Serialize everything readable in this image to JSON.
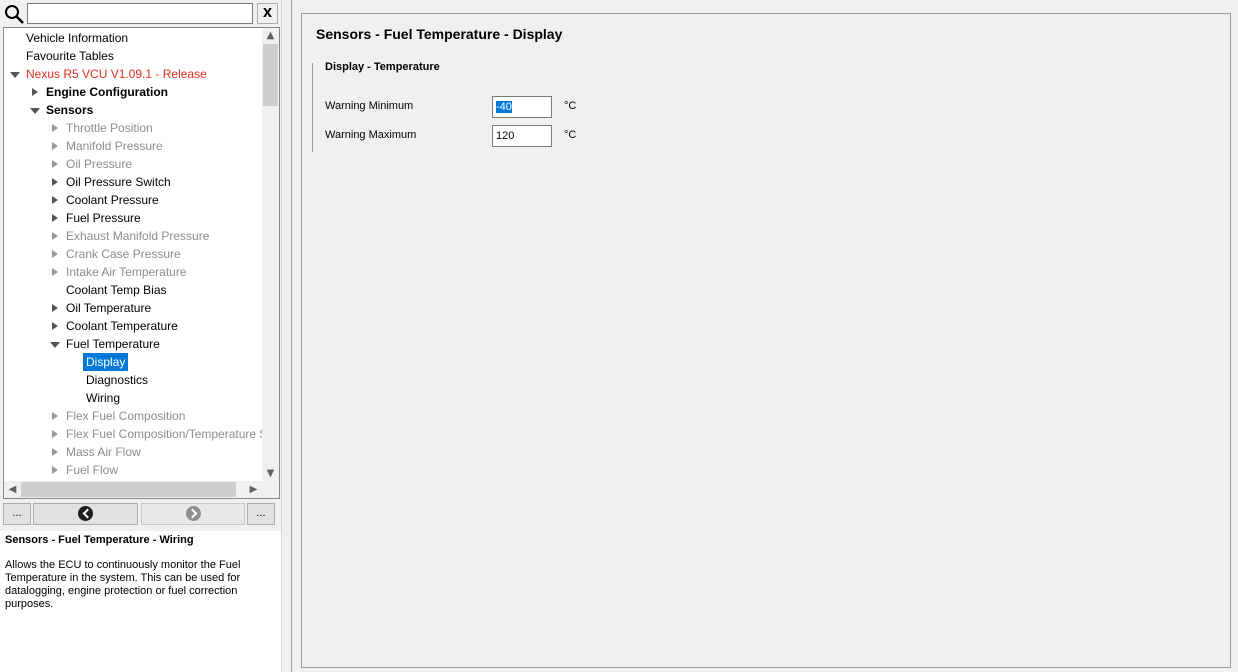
{
  "search": {
    "placeholder": "",
    "clear_label": "X"
  },
  "tree": {
    "items": [
      {
        "label": "Vehicle Information",
        "level": 0,
        "expander": "none",
        "style": "normal"
      },
      {
        "label": "Favourite Tables",
        "level": 0,
        "expander": "none",
        "style": "normal"
      },
      {
        "label": "Nexus R5 VCU V1.09.1 - Release",
        "level": 0,
        "expander": "expanded",
        "style": "red"
      },
      {
        "label": "Engine Configuration",
        "level": 1,
        "expander": "collapsed",
        "style": "bold"
      },
      {
        "label": "Sensors",
        "level": 1,
        "expander": "expanded",
        "style": "bold"
      },
      {
        "label": "Throttle Position",
        "level": 2,
        "expander": "collapsed",
        "style": "disabled"
      },
      {
        "label": "Manifold Pressure",
        "level": 2,
        "expander": "collapsed",
        "style": "disabled"
      },
      {
        "label": "Oil Pressure",
        "level": 2,
        "expander": "collapsed",
        "style": "disabled"
      },
      {
        "label": "Oil Pressure Switch",
        "level": 2,
        "expander": "collapsed",
        "style": "normal"
      },
      {
        "label": "Coolant Pressure",
        "level": 2,
        "expander": "collapsed",
        "style": "normal"
      },
      {
        "label": "Fuel Pressure",
        "level": 2,
        "expander": "collapsed",
        "style": "normal"
      },
      {
        "label": "Exhaust Manifold Pressure",
        "level": 2,
        "expander": "collapsed",
        "style": "disabled"
      },
      {
        "label": "Crank Case Pressure",
        "level": 2,
        "expander": "collapsed",
        "style": "disabled"
      },
      {
        "label": "Intake Air Temperature",
        "level": 2,
        "expander": "collapsed",
        "style": "disabled"
      },
      {
        "label": "Coolant Temp Bias",
        "level": 2,
        "expander": "none",
        "style": "normal"
      },
      {
        "label": "Oil Temperature",
        "level": 2,
        "expander": "collapsed",
        "style": "normal"
      },
      {
        "label": "Coolant Temperature",
        "level": 2,
        "expander": "collapsed",
        "style": "normal"
      },
      {
        "label": "Fuel Temperature",
        "level": 2,
        "expander": "expanded",
        "style": "normal"
      },
      {
        "label": "Display",
        "level": 3,
        "expander": "none",
        "style": "selected"
      },
      {
        "label": "Diagnostics",
        "level": 3,
        "expander": "none",
        "style": "normal"
      },
      {
        "label": "Wiring",
        "level": 3,
        "expander": "none",
        "style": "normal"
      },
      {
        "label": "Flex Fuel Composition",
        "level": 2,
        "expander": "collapsed",
        "style": "disabled"
      },
      {
        "label": "Flex Fuel Composition/Temperature Sensor",
        "level": 2,
        "expander": "collapsed",
        "style": "disabled"
      },
      {
        "label": "Mass Air Flow",
        "level": 2,
        "expander": "collapsed",
        "style": "disabled"
      },
      {
        "label": "Fuel Flow",
        "level": 2,
        "expander": "collapsed",
        "style": "disabled"
      }
    ]
  },
  "nav": {
    "more_left": "...",
    "more_right": "..."
  },
  "description": {
    "title": "Sensors - Fuel Temperature - Wiring",
    "body": "Allows the ECU to continuously monitor the Fuel Temperature in the system. This can be used for datalogging, engine protection or fuel correction purposes."
  },
  "main": {
    "title": "Sensors - Fuel Temperature - Display",
    "group_title": "Display - Temperature",
    "fields": [
      {
        "label": "Warning Minimum",
        "value": "-40",
        "unit": "°C",
        "selected": true
      },
      {
        "label": "Warning Maximum",
        "value": "120",
        "unit": "°C",
        "selected": false
      }
    ]
  },
  "colors": {
    "selection": "#0078d7",
    "root_text": "#e0301e",
    "disabled_text": "#8c8c8c"
  }
}
